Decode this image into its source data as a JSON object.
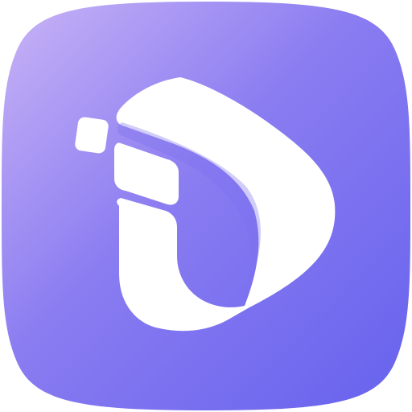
{
  "app_icon": {
    "name": "app-logo",
    "colors": {
      "gradient_start": "#c9b4f6",
      "gradient_mid": "#8a7cf1",
      "gradient_end": "#6662ee",
      "glyph": "#ffffff"
    },
    "icons": [
      "app-icon",
      "stylized-i-d-logo-icon"
    ]
  }
}
